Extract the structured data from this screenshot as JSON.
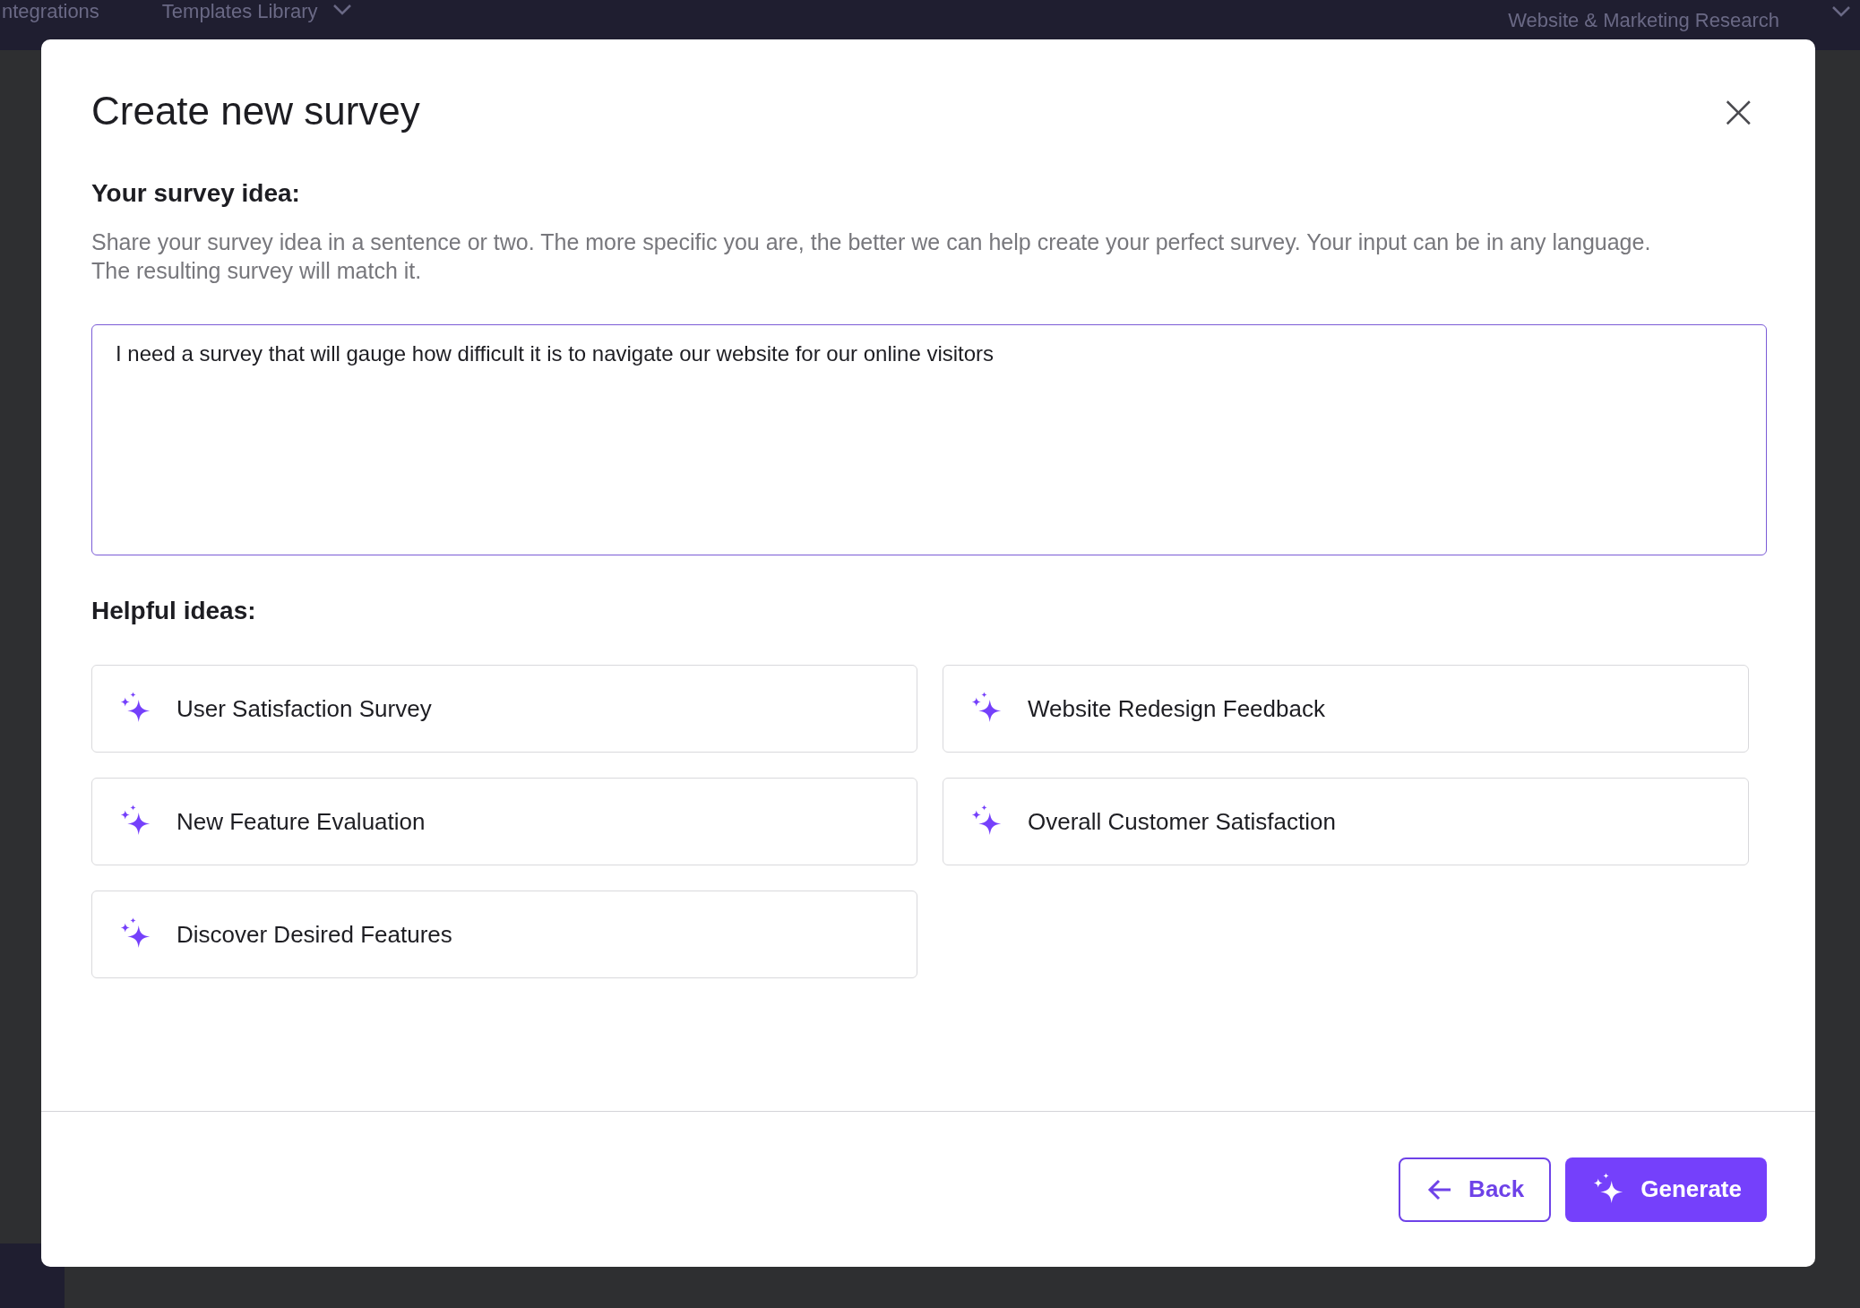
{
  "background_app": {
    "top_bar": {
      "items": [
        "ntegrations",
        "Templates Library"
      ],
      "project": "Website & Marketing Research"
    }
  },
  "dialog": {
    "title": "Create new survey",
    "close_label": "×",
    "idea_section": {
      "heading": "Your survey idea:",
      "description": "Share your survey idea in a sentence or two. The more specific you are, the better we can help create your perfect survey. Your input can be in any language. The resulting survey will match it.",
      "value": "I need a survey that will gauge how difficult it is to navigate our website for our online visitors"
    },
    "helpful_ideas": {
      "heading": "Helpful ideas:",
      "items": [
        {
          "label": "User Satisfaction Survey"
        },
        {
          "label": "Website Redesign Feedback"
        },
        {
          "label": "New Feature Evaluation"
        },
        {
          "label": "Overall Customer Satisfaction"
        },
        {
          "label": "Discover Desired Features"
        }
      ]
    },
    "buttons": [
      {
        "label": "Back",
        "kind": "secondary"
      },
      {
        "label": "Generate",
        "kind": "primary"
      }
    ]
  }
}
